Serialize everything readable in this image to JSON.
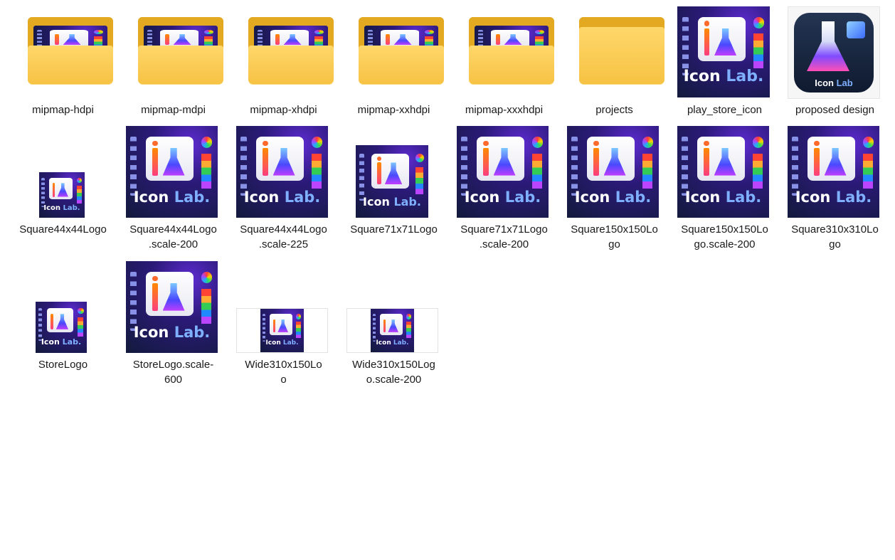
{
  "window": {
    "background": "#ffffff"
  },
  "art_text": {
    "word1": "Icon",
    "word2": "Lab."
  },
  "proposed_text": {
    "word1": "Icon",
    "word2": "Lab"
  },
  "folders": [
    {
      "name": "mipmap-hdpi",
      "has_preview": true
    },
    {
      "name": "mipmap-mdpi",
      "has_preview": true
    },
    {
      "name": "mipmap-xhdpi",
      "has_preview": true
    },
    {
      "name": "mipmap-xxhdpi",
      "has_preview": true
    },
    {
      "name": "mipmap-xxxhdpi",
      "has_preview": true
    },
    {
      "name": "projects",
      "has_preview": false
    }
  ],
  "files": [
    {
      "line1": "play_store_icon",
      "line2": ""
    },
    {
      "line1": "proposed design",
      "line2": ""
    },
    {
      "line1": "Square44x44Logo",
      "line2": ""
    },
    {
      "line1": "Square44x44Logo",
      "line2": ".scale-200"
    },
    {
      "line1": "Square44x44Logo",
      "line2": ".scale-225"
    },
    {
      "line1": "Square71x71Logo",
      "line2": ""
    },
    {
      "line1": "Square71x71Logo",
      "line2": ".scale-200"
    },
    {
      "line1": "Square150x150Lo",
      "line2": "go"
    },
    {
      "line1": "Square150x150Lo",
      "line2": "go.scale-200"
    },
    {
      "line1": "Square310x310Lo",
      "line2": "go"
    },
    {
      "line1": "StoreLogo",
      "line2": ""
    },
    {
      "line1": "StoreLogo.scale-",
      "line2": "600"
    },
    {
      "line1": "Wide310x150Lo",
      "line2": "o"
    },
    {
      "line1": "Wide310x150Log",
      "line2": "o.scale-200"
    }
  ],
  "folder_colors": {
    "back": "#e3a920",
    "front": "#f6c243"
  }
}
